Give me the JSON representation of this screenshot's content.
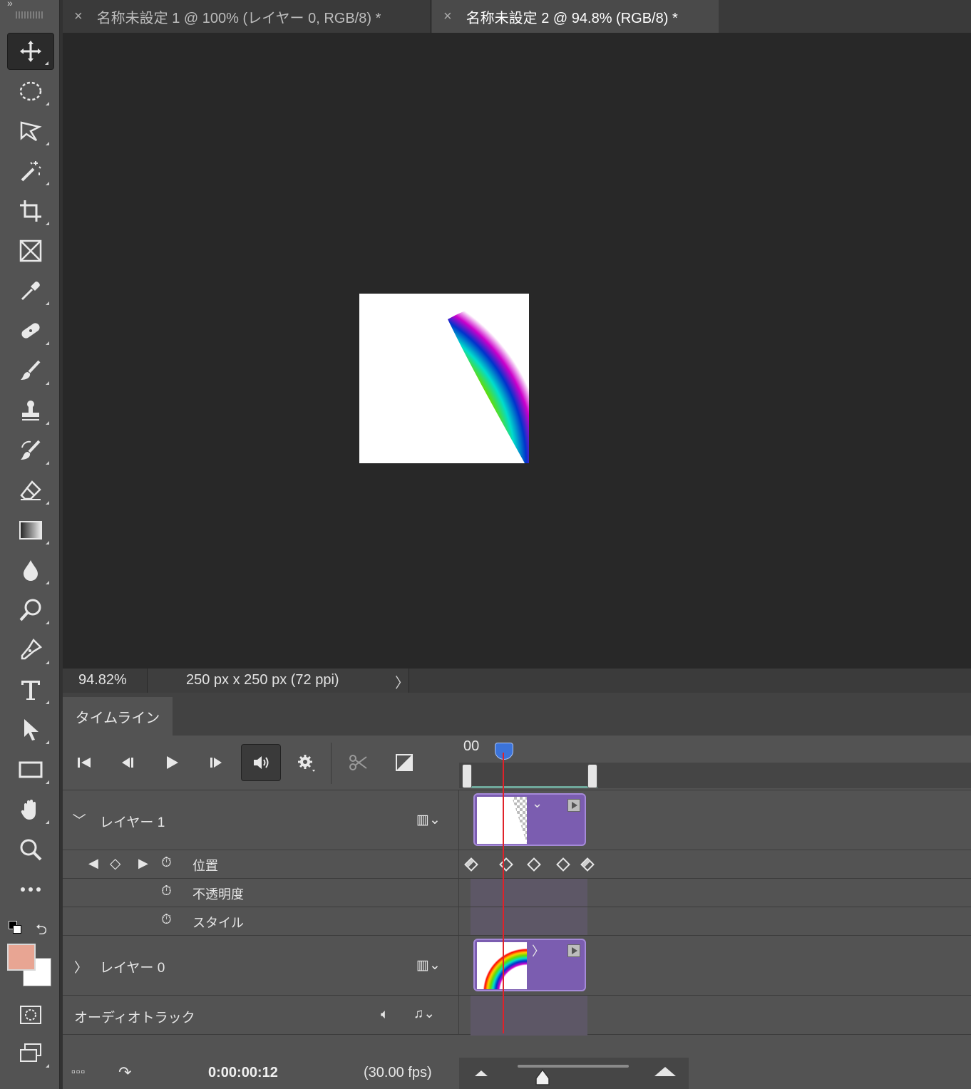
{
  "tabs": [
    {
      "label": "名称未設定 1 @ 100% (レイヤー 0, RGB/8) *",
      "close": "×"
    },
    {
      "label": "名称未設定 2 @ 94.8% (RGB/8) *",
      "close": "×"
    }
  ],
  "status": {
    "zoom": "94.82%",
    "doc_info": "250 px x 250 px (72 ppi)",
    "arrow": "〉"
  },
  "timeline": {
    "panel_tab": "タイムライン",
    "ruler_label": "00",
    "layers": [
      {
        "name": "レイヤー 1",
        "expand": "〉"
      },
      {
        "name": "レイヤー 0",
        "expand": "〉"
      }
    ],
    "properties": [
      "位置",
      "不透明度",
      "スタイル"
    ],
    "audio_track": "オーディオトラック",
    "timecode": "0:00:00:12",
    "fps": "(30.00 fps)"
  },
  "colors": {
    "foreground": "#e8a593",
    "background": "#ffffff",
    "playhead": "#e0222a",
    "clip": "#7b5db0"
  },
  "tools": [
    "move-tool",
    "marquee-tool",
    "lasso-tool",
    "magic-wand-tool",
    "crop-tool",
    "frame-tool",
    "eyedropper-tool",
    "healing-tool",
    "brush-tool",
    "stamp-tool",
    "history-brush-tool",
    "eraser-tool",
    "gradient-tool",
    "blur-tool",
    "dodge-tool",
    "pen-tool",
    "type-tool",
    "path-selection-tool",
    "rectangle-tool",
    "hand-tool",
    "zoom-tool",
    "more-tools"
  ]
}
